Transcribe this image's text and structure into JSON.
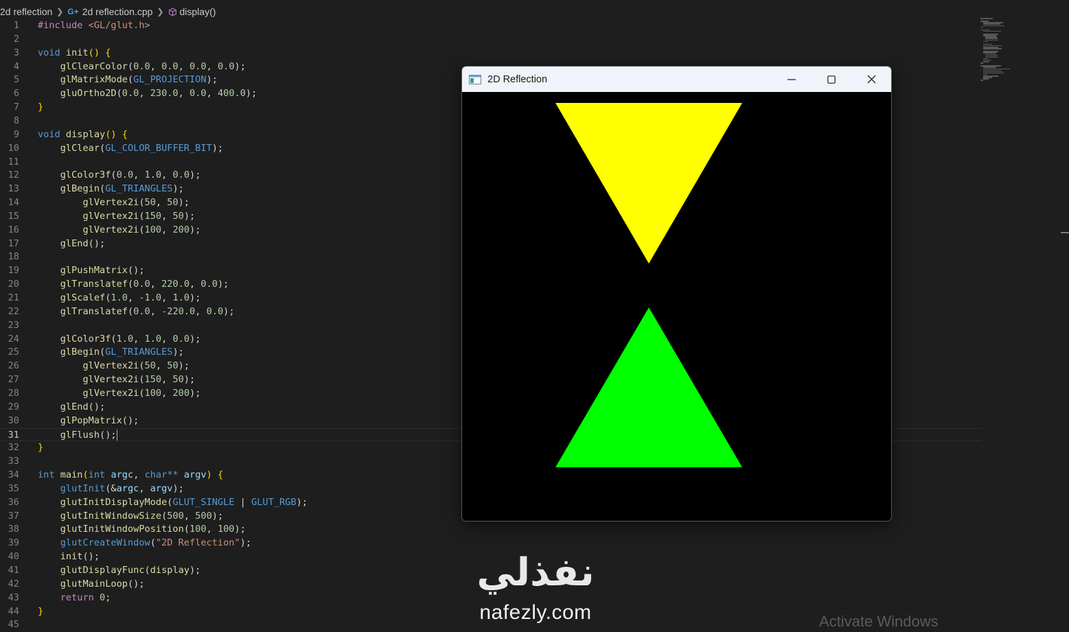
{
  "breadcrumb": {
    "folder": "2d reflection",
    "file": "2d reflection.cpp",
    "file_icon_text": "G",
    "symbol": "display()"
  },
  "editor": {
    "current_line": 31,
    "lines": [
      {
        "n": "1",
        "tokens": [
          [
            "pre",
            "#include "
          ],
          [
            "str",
            "<GL/glut.h>"
          ]
        ]
      },
      {
        "n": "2",
        "tokens": []
      },
      {
        "n": "3",
        "tokens": [
          [
            "kw",
            "void "
          ],
          [
            "fn",
            "init"
          ],
          [
            "brace",
            "() {"
          ]
        ]
      },
      {
        "n": "4",
        "tokens": [
          [
            "pun",
            "    "
          ],
          [
            "fn",
            "glClearColor"
          ],
          [
            "pun",
            "("
          ],
          [
            "num",
            "0.0"
          ],
          [
            "pun",
            ", "
          ],
          [
            "num",
            "0.0"
          ],
          [
            "pun",
            ", "
          ],
          [
            "num",
            "0.0"
          ],
          [
            "pun",
            ", "
          ],
          [
            "num",
            "0.0"
          ],
          [
            "pun",
            ");"
          ]
        ]
      },
      {
        "n": "5",
        "tokens": [
          [
            "pun",
            "    "
          ],
          [
            "fn",
            "glMatrixMode"
          ],
          [
            "pun",
            "("
          ],
          [
            "mac",
            "GL_PROJECTION"
          ],
          [
            "pun",
            ");"
          ]
        ]
      },
      {
        "n": "6",
        "tokens": [
          [
            "pun",
            "    "
          ],
          [
            "fn",
            "gluOrtho2D"
          ],
          [
            "pun",
            "("
          ],
          [
            "num",
            "0.0"
          ],
          [
            "pun",
            ", "
          ],
          [
            "num",
            "230.0"
          ],
          [
            "pun",
            ", "
          ],
          [
            "num",
            "0.0"
          ],
          [
            "pun",
            ", "
          ],
          [
            "num",
            "400.0"
          ],
          [
            "pun",
            ");"
          ]
        ]
      },
      {
        "n": "7",
        "tokens": [
          [
            "brace",
            "}"
          ]
        ]
      },
      {
        "n": "8",
        "tokens": []
      },
      {
        "n": "9",
        "tokens": [
          [
            "kw",
            "void "
          ],
          [
            "fn",
            "display"
          ],
          [
            "brace",
            "() {"
          ]
        ]
      },
      {
        "n": "10",
        "tokens": [
          [
            "pun",
            "    "
          ],
          [
            "fn",
            "glClear"
          ],
          [
            "pun",
            "("
          ],
          [
            "mac",
            "GL_COLOR_BUFFER_BIT"
          ],
          [
            "pun",
            ");"
          ]
        ]
      },
      {
        "n": "11",
        "tokens": []
      },
      {
        "n": "12",
        "tokens": [
          [
            "pun",
            "    "
          ],
          [
            "fn",
            "glColor3f"
          ],
          [
            "pun",
            "("
          ],
          [
            "num",
            "0.0"
          ],
          [
            "pun",
            ", "
          ],
          [
            "num",
            "1.0"
          ],
          [
            "pun",
            ", "
          ],
          [
            "num",
            "0.0"
          ],
          [
            "pun",
            ");"
          ]
        ]
      },
      {
        "n": "13",
        "tokens": [
          [
            "pun",
            "    "
          ],
          [
            "fn",
            "glBegin"
          ],
          [
            "pun",
            "("
          ],
          [
            "mac",
            "GL_TRIANGLES"
          ],
          [
            "pun",
            ");"
          ]
        ]
      },
      {
        "n": "14",
        "tokens": [
          [
            "pun",
            "        "
          ],
          [
            "fn",
            "glVertex2i"
          ],
          [
            "pun",
            "("
          ],
          [
            "num",
            "50"
          ],
          [
            "pun",
            ", "
          ],
          [
            "num",
            "50"
          ],
          [
            "pun",
            ");"
          ]
        ]
      },
      {
        "n": "15",
        "tokens": [
          [
            "pun",
            "        "
          ],
          [
            "fn",
            "glVertex2i"
          ],
          [
            "pun",
            "("
          ],
          [
            "num",
            "150"
          ],
          [
            "pun",
            ", "
          ],
          [
            "num",
            "50"
          ],
          [
            "pun",
            ");"
          ]
        ]
      },
      {
        "n": "16",
        "tokens": [
          [
            "pun",
            "        "
          ],
          [
            "fn",
            "glVertex2i"
          ],
          [
            "pun",
            "("
          ],
          [
            "num",
            "100"
          ],
          [
            "pun",
            ", "
          ],
          [
            "num",
            "200"
          ],
          [
            "pun",
            ");"
          ]
        ]
      },
      {
        "n": "17",
        "tokens": [
          [
            "pun",
            "    "
          ],
          [
            "fn",
            "glEnd"
          ],
          [
            "pun",
            "();"
          ]
        ]
      },
      {
        "n": "18",
        "tokens": []
      },
      {
        "n": "19",
        "tokens": [
          [
            "pun",
            "    "
          ],
          [
            "fn",
            "glPushMatrix"
          ],
          [
            "pun",
            "();"
          ]
        ]
      },
      {
        "n": "20",
        "tokens": [
          [
            "pun",
            "    "
          ],
          [
            "fn",
            "glTranslatef"
          ],
          [
            "pun",
            "("
          ],
          [
            "num",
            "0.0"
          ],
          [
            "pun",
            ", "
          ],
          [
            "num",
            "220.0"
          ],
          [
            "pun",
            ", "
          ],
          [
            "num",
            "0.0"
          ],
          [
            "pun",
            ");"
          ]
        ]
      },
      {
        "n": "21",
        "tokens": [
          [
            "pun",
            "    "
          ],
          [
            "fn",
            "glScalef"
          ],
          [
            "pun",
            "("
          ],
          [
            "num",
            "1.0"
          ],
          [
            "pun",
            ", "
          ],
          [
            "num",
            "-1.0"
          ],
          [
            "pun",
            ", "
          ],
          [
            "num",
            "1.0"
          ],
          [
            "pun",
            ");"
          ]
        ]
      },
      {
        "n": "22",
        "tokens": [
          [
            "pun",
            "    "
          ],
          [
            "fn",
            "glTranslatef"
          ],
          [
            "pun",
            "("
          ],
          [
            "num",
            "0.0"
          ],
          [
            "pun",
            ", "
          ],
          [
            "num",
            "-220.0"
          ],
          [
            "pun",
            ", "
          ],
          [
            "num",
            "0.0"
          ],
          [
            "pun",
            ");"
          ]
        ]
      },
      {
        "n": "23",
        "tokens": []
      },
      {
        "n": "24",
        "tokens": [
          [
            "pun",
            "    "
          ],
          [
            "fn",
            "glColor3f"
          ],
          [
            "pun",
            "("
          ],
          [
            "num",
            "1.0"
          ],
          [
            "pun",
            ", "
          ],
          [
            "num",
            "1.0"
          ],
          [
            "pun",
            ", "
          ],
          [
            "num",
            "0.0"
          ],
          [
            "pun",
            ");"
          ]
        ]
      },
      {
        "n": "25",
        "tokens": [
          [
            "pun",
            "    "
          ],
          [
            "fn",
            "glBegin"
          ],
          [
            "pun",
            "("
          ],
          [
            "mac",
            "GL_TRIANGLES"
          ],
          [
            "pun",
            ");"
          ]
        ]
      },
      {
        "n": "26",
        "tokens": [
          [
            "pun",
            "        "
          ],
          [
            "fn",
            "glVertex2i"
          ],
          [
            "pun",
            "("
          ],
          [
            "num",
            "50"
          ],
          [
            "pun",
            ", "
          ],
          [
            "num",
            "50"
          ],
          [
            "pun",
            ");"
          ]
        ]
      },
      {
        "n": "27",
        "tokens": [
          [
            "pun",
            "        "
          ],
          [
            "fn",
            "glVertex2i"
          ],
          [
            "pun",
            "("
          ],
          [
            "num",
            "150"
          ],
          [
            "pun",
            ", "
          ],
          [
            "num",
            "50"
          ],
          [
            "pun",
            ");"
          ]
        ]
      },
      {
        "n": "28",
        "tokens": [
          [
            "pun",
            "        "
          ],
          [
            "fn",
            "glVertex2i"
          ],
          [
            "pun",
            "("
          ],
          [
            "num",
            "100"
          ],
          [
            "pun",
            ", "
          ],
          [
            "num",
            "200"
          ],
          [
            "pun",
            ");"
          ]
        ]
      },
      {
        "n": "29",
        "tokens": [
          [
            "pun",
            "    "
          ],
          [
            "fn",
            "glEnd"
          ],
          [
            "pun",
            "();"
          ]
        ]
      },
      {
        "n": "30",
        "tokens": [
          [
            "pun",
            "    "
          ],
          [
            "fn",
            "glPopMatrix"
          ],
          [
            "pun",
            "();"
          ]
        ]
      },
      {
        "n": "31",
        "tokens": [
          [
            "pun",
            "    "
          ],
          [
            "fn",
            "glFlush"
          ],
          [
            "pun",
            "();"
          ]
        ]
      },
      {
        "n": "32",
        "tokens": [
          [
            "brace",
            "}"
          ]
        ]
      },
      {
        "n": "33",
        "tokens": []
      },
      {
        "n": "34",
        "tokens": [
          [
            "kw",
            "int "
          ],
          [
            "fn",
            "main"
          ],
          [
            "brace",
            "("
          ],
          [
            "kw",
            "int "
          ],
          [
            "var",
            "argc"
          ],
          [
            "pun",
            ", "
          ],
          [
            "kw",
            "char"
          ],
          [
            "kw",
            "** "
          ],
          [
            "var",
            "argv"
          ],
          [
            "brace",
            ") {"
          ]
        ]
      },
      {
        "n": "35",
        "tokens": [
          [
            "pun",
            "    "
          ],
          [
            "mac",
            "glutInit"
          ],
          [
            "pun",
            "(&"
          ],
          [
            "var",
            "argc"
          ],
          [
            "pun",
            ", "
          ],
          [
            "var",
            "argv"
          ],
          [
            "pun",
            ");"
          ]
        ]
      },
      {
        "n": "36",
        "tokens": [
          [
            "pun",
            "    "
          ],
          [
            "fn",
            "glutInitDisplayMode"
          ],
          [
            "pun",
            "("
          ],
          [
            "mac",
            "GLUT_SINGLE"
          ],
          [
            "pun",
            " | "
          ],
          [
            "mac",
            "GLUT_RGB"
          ],
          [
            "pun",
            ");"
          ]
        ]
      },
      {
        "n": "37",
        "tokens": [
          [
            "pun",
            "    "
          ],
          [
            "fn",
            "glutInitWindowSize"
          ],
          [
            "pun",
            "("
          ],
          [
            "num",
            "500"
          ],
          [
            "pun",
            ", "
          ],
          [
            "num",
            "500"
          ],
          [
            "pun",
            ");"
          ]
        ]
      },
      {
        "n": "38",
        "tokens": [
          [
            "pun",
            "    "
          ],
          [
            "fn",
            "glutInitWindowPosition"
          ],
          [
            "pun",
            "("
          ],
          [
            "num",
            "100"
          ],
          [
            "pun",
            ", "
          ],
          [
            "num",
            "100"
          ],
          [
            "pun",
            ");"
          ]
        ]
      },
      {
        "n": "39",
        "tokens": [
          [
            "pun",
            "    "
          ],
          [
            "mac",
            "glutCreateWindow"
          ],
          [
            "pun",
            "("
          ],
          [
            "str",
            "\"2D Reflection\""
          ],
          [
            "pun",
            ");"
          ]
        ]
      },
      {
        "n": "40",
        "tokens": [
          [
            "pun",
            "    "
          ],
          [
            "fn",
            "init"
          ],
          [
            "pun",
            "();"
          ]
        ]
      },
      {
        "n": "41",
        "tokens": [
          [
            "pun",
            "    "
          ],
          [
            "fn",
            "glutDisplayFunc"
          ],
          [
            "pun",
            "("
          ],
          [
            "fn",
            "display"
          ],
          [
            "pun",
            ");"
          ]
        ]
      },
      {
        "n": "42",
        "tokens": [
          [
            "pun",
            "    "
          ],
          [
            "fn",
            "glutMainLoop"
          ],
          [
            "pun",
            "();"
          ]
        ]
      },
      {
        "n": "43",
        "tokens": [
          [
            "pun",
            "    "
          ],
          [
            "kwc",
            "return "
          ],
          [
            "num",
            "0"
          ],
          [
            "pun",
            ";"
          ]
        ]
      },
      {
        "n": "44",
        "tokens": [
          [
            "brace",
            "}"
          ]
        ]
      },
      {
        "n": "45",
        "tokens": []
      }
    ]
  },
  "gl_window": {
    "title": "2D Reflection",
    "minimize_icon": "minimize-icon",
    "maximize_icon": "maximize-icon",
    "close_icon": "close-icon",
    "triangle_top_color": "#ffff00",
    "triangle_bottom_color": "#00ff00"
  },
  "watermark": {
    "arabic": "نفذلي",
    "url": "nafezly.com"
  },
  "activate_text": "Activate Windows"
}
